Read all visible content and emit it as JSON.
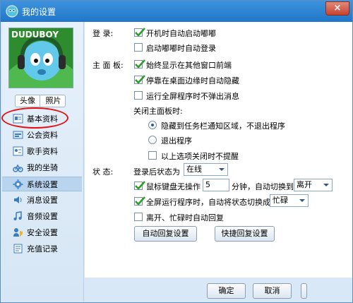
{
  "window": {
    "title": "我的设置",
    "close_label": "×"
  },
  "sidebar": {
    "avatar_text": "DUDUBOY",
    "avatar_tabs": [
      "头像",
      "照片"
    ],
    "items": [
      {
        "label": "基本资料",
        "icon": "profile-card-icon",
        "active": false
      },
      {
        "label": "公会资料",
        "icon": "guild-icon",
        "active": false
      },
      {
        "label": "歌手资料",
        "icon": "singer-card-icon",
        "active": false
      },
      {
        "label": "我的坐骑",
        "icon": "mount-icon",
        "active": false
      },
      {
        "label": "系统设置",
        "icon": "gear-icon",
        "active": true
      },
      {
        "label": "消息设置",
        "icon": "speaker-icon",
        "active": false
      },
      {
        "label": "音频设置",
        "icon": "music-note-icon",
        "active": false
      },
      {
        "label": "安全设置",
        "icon": "security-icon",
        "active": false
      },
      {
        "label": "充值记录",
        "icon": "record-icon",
        "active": false
      }
    ]
  },
  "login": {
    "section_label": "登    录:",
    "options": [
      {
        "label": "开机时自动启动嘟嘟",
        "checked": true
      },
      {
        "label": "启动嘟嘟时自动登录",
        "checked": false
      }
    ]
  },
  "main_panel": {
    "section_label": "主 面 板:",
    "options": [
      {
        "label": "始终显示在其他窗口前端",
        "checked": true
      },
      {
        "label": "停靠在桌面边缘时自动隐藏",
        "checked": true
      },
      {
        "label": "运行全屏程序时不弹出消息",
        "checked": false
      }
    ],
    "close_label": "关闭主面板时:",
    "close_options": [
      {
        "label": "隐藏到任务栏通知区域，不退出程序",
        "selected": true
      },
      {
        "label": "退出程序",
        "selected": false
      }
    ],
    "no_remind": {
      "label": "以上选项关闭时不提醒",
      "checked": false
    }
  },
  "status": {
    "section_label": "状    态:",
    "login_status_label": "登录后状态为",
    "login_status_value": "在线",
    "idle": {
      "label": "鼠标键盘无操作",
      "checked": true,
      "minutes": "5",
      "suffix": "分钟，自动切换到",
      "target": "离开"
    },
    "fullscreen": {
      "label": "全屏运行程序时，自动将状态切换成",
      "checked": true,
      "target": "忙碌"
    },
    "auto_reply": {
      "label": "离开、忙碌时自动回复",
      "checked": false
    },
    "auto_reply_button": "自动回复设置",
    "quick_reply_button": "快捷回复设置"
  },
  "footer": {
    "ok_button": "确定",
    "cancel_button": "取消"
  }
}
